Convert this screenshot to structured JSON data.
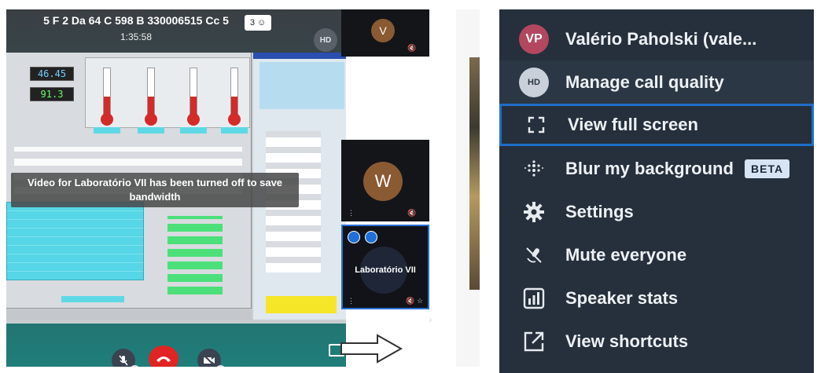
{
  "meeting": {
    "title": "5 F 2 Da 64 C 598 B 330006515 Cc 5",
    "elapsed": "1:35:58",
    "participant_count": "3",
    "quality_badge": "HD",
    "bandwidth_message": "Video for Laboratório VII has been turned off to save bandwidth",
    "shared_screen": {
      "lcd_values": [
        "46.45",
        "91.3"
      ]
    },
    "thumbnails": [
      {
        "initial": "V",
        "avatar_color": "#8a5a33"
      },
      {
        "initial": "W",
        "avatar_color": "#8a5a33"
      },
      {
        "name": "Laboratório VII",
        "border_color": "#2a6fd6"
      }
    ],
    "controls": {
      "hangup_color": "#e02424",
      "more_icon": "⋮"
    }
  },
  "menu": {
    "items": [
      {
        "label": "Valério Paholski (vale...",
        "avatar_initials": "VP",
        "avatar_color": "#b3475f"
      },
      {
        "label": "Manage call quality",
        "avatar_initials": "HD"
      },
      {
        "label": "View full screen",
        "icon": "fullscreen-icon",
        "highlight_color": "#1f6ec8"
      },
      {
        "label": "Blur my background",
        "icon": "blur-icon",
        "badge": "BETA"
      },
      {
        "label": "Settings",
        "icon": "gear-icon"
      },
      {
        "label": "Mute everyone",
        "icon": "mic-off-icon"
      },
      {
        "label": "Speaker stats",
        "icon": "stats-icon"
      },
      {
        "label": "View shortcuts",
        "icon": "shortcut-icon"
      }
    ],
    "background": "#25303c"
  }
}
